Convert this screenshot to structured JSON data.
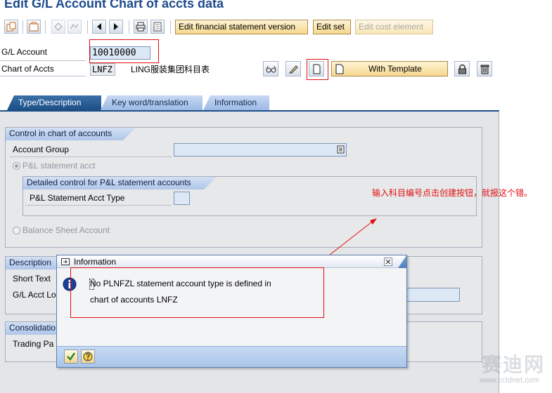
{
  "window": {
    "title": "Edit G/L Account Chart of accts data"
  },
  "toolbar": {
    "edit_fs_version": "Edit financial statement version",
    "edit_set": "Edit set",
    "edit_cost_element": "Edit cost element"
  },
  "header": {
    "gl_account_label": "G/L Account",
    "gl_account_value": "10010000",
    "chart_label": "Chart of Accts",
    "chart_value": "LNFZ",
    "chart_desc": "LING服装集团科目表",
    "with_template": "With Template"
  },
  "tabs": [
    {
      "label": "Type/Description"
    },
    {
      "label": "Key word/translation"
    },
    {
      "label": "Information"
    }
  ],
  "control": {
    "heading": "Control in chart of accounts",
    "account_group_label": "Account Group",
    "account_group_value": "",
    "pl_radio_label": "P&L statement acct",
    "detail_heading": "Detailed control for P&L statement accounts",
    "pl_type_label": "P&L Statement Acct Type",
    "pl_type_value": "",
    "bs_radio_label": "Balance Sheet Account"
  },
  "description": {
    "heading": "Description",
    "short_text_label": "Short Text",
    "long_text_label": "G/L Acct Lo"
  },
  "consolidation": {
    "heading": "Consolidatio",
    "trading_label": "Trading Pa"
  },
  "annotation": {
    "text": "输入科目编号点击创建按钮，就报这个错。"
  },
  "dialog": {
    "title": "Information",
    "line1": "No PLNFZL statement account type is defined in",
    "line2": "chart of accounts LNFZ"
  },
  "watermark": {
    "text": "赛迪网",
    "url": "www.ccidnet.com"
  }
}
